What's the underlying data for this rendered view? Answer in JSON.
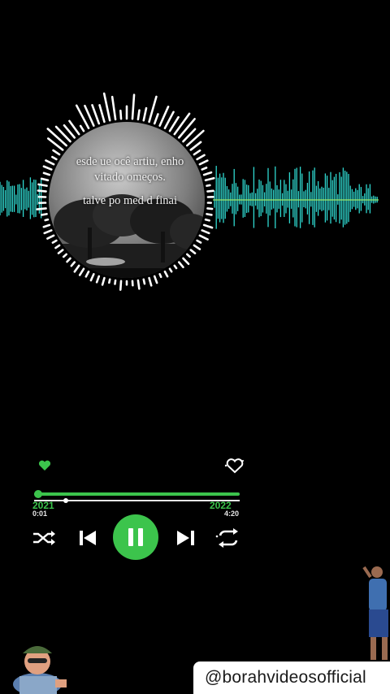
{
  "lyrics": {
    "line1": "esde ue ocê artiu, enho",
    "line2": "vitado omeços.",
    "line3": "talve po med d finai"
  },
  "player": {
    "favorite_icon": "heart-filled-icon",
    "like_icon": "heart-outline-icon",
    "elapsed_time": "0:01",
    "total_time": "4:20",
    "year_left": "2021",
    "year_right": "2022",
    "progress": 0.02,
    "shuffle_icon": "shuffle-icon",
    "prev_icon": "skip-previous-icon",
    "play_pause_icon": "pause-icon",
    "next_icon": "skip-next-icon",
    "repeat_icon": "repeat-icon"
  },
  "watermark": {
    "handle": "@borahvideosofficial"
  },
  "colors": {
    "accent_green": "#3cc44c",
    "wave_cyan": "#2fd8d0",
    "ring_white": "#ffffff",
    "background": "#000000"
  }
}
